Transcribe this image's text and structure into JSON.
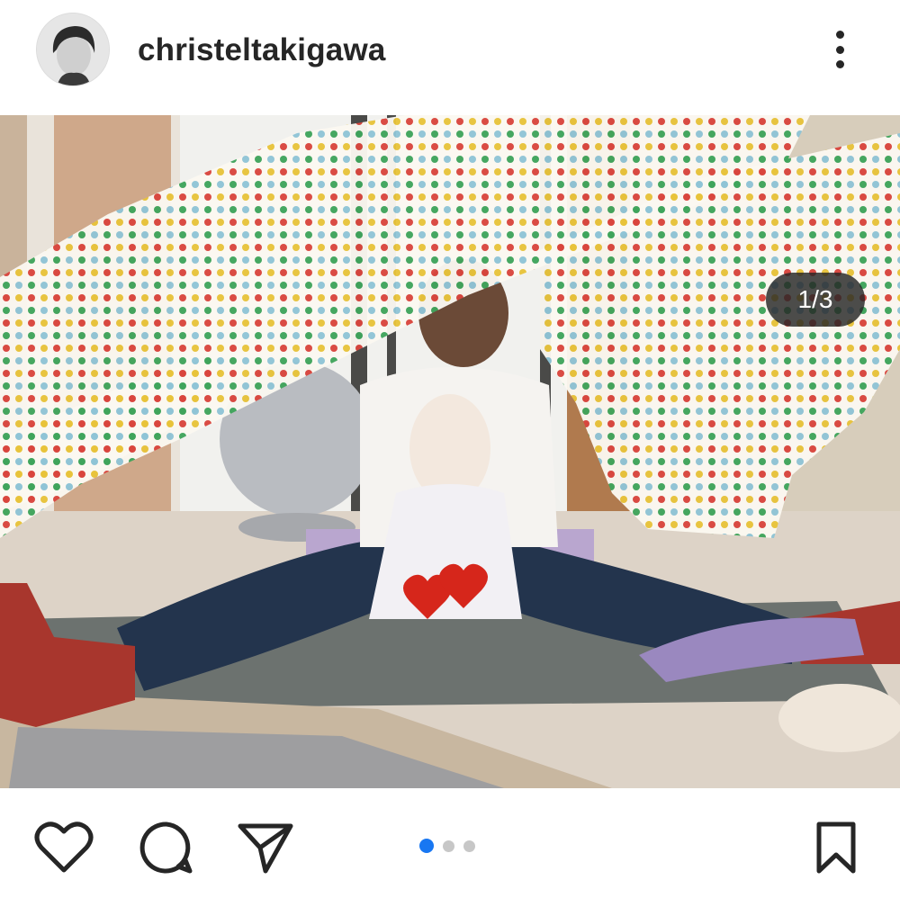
{
  "post": {
    "username": "christeltakigawa",
    "counter": "1/3",
    "carousel": {
      "total": 3,
      "active_index": 0
    },
    "colors": {
      "accent": "#1877f2",
      "text": "#262626",
      "dot_inactive": "#c7c7c7"
    }
  },
  "icons": {
    "more": "more-vertical-icon",
    "tag": "person-tag-icon",
    "like": "heart-icon",
    "comment": "comment-bubble-icon",
    "share": "paper-plane-icon",
    "save": "bookmark-icon"
  }
}
